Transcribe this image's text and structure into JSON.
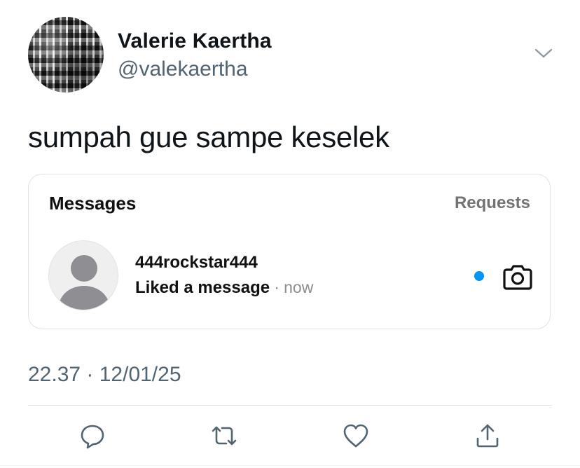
{
  "tweet": {
    "author": {
      "display_name": "Valerie Kaertha",
      "handle": "@valekaertha"
    },
    "text": "sumpah gue sampe keselek",
    "timestamp": "22.37 · 12/01/25"
  },
  "embedded_screenshot": {
    "title": "Messages",
    "requests_label": "Requests",
    "conversation": {
      "username": "444rockstar444",
      "status": "Liked a message",
      "separator": "·",
      "time": "now",
      "unread": true
    }
  },
  "actions": [
    {
      "icon": "reply-icon"
    },
    {
      "icon": "retweet-icon"
    },
    {
      "icon": "like-icon"
    },
    {
      "icon": "share-icon"
    }
  ],
  "colors": {
    "text": "#0f1419",
    "secondary": "#536471",
    "unread_dot": "#0095f6",
    "border": "#dfe3e8"
  }
}
